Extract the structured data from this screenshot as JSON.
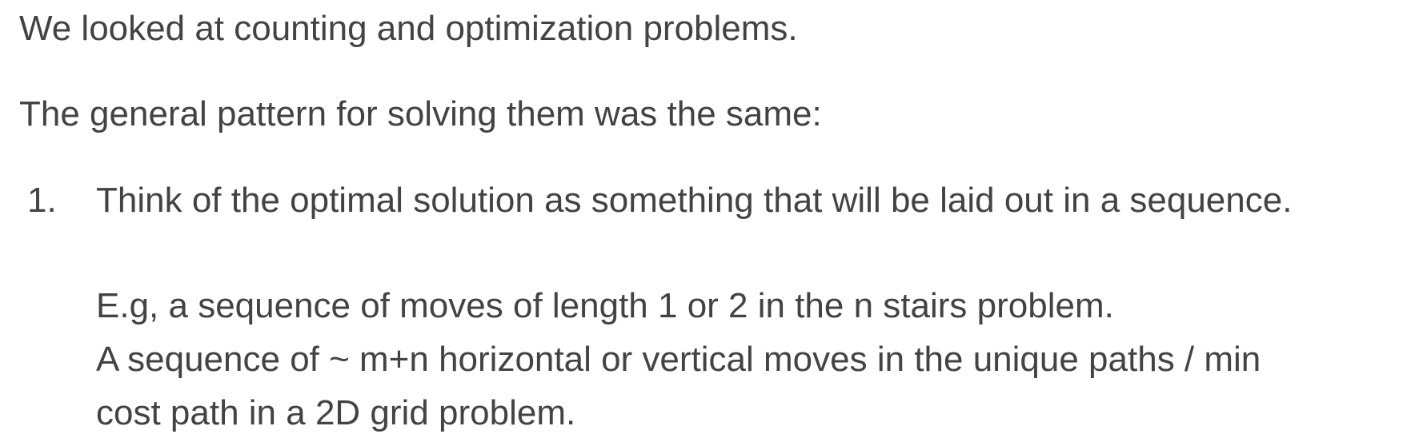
{
  "paragraphs": {
    "intro": "We looked at counting and optimization problems.",
    "pattern": "The general pattern for solving them was the same:"
  },
  "list": {
    "items": [
      {
        "number": "1.",
        "text": "Think of the optimal solution as something that will be laid out in a sequence.",
        "examples": [
          "E.g, a sequence of moves of length 1 or 2 in the n stairs problem.",
          "A sequence of ~ m+n horizontal or vertical moves in the unique paths / min",
          "cost path in a 2D grid problem."
        ]
      }
    ]
  }
}
